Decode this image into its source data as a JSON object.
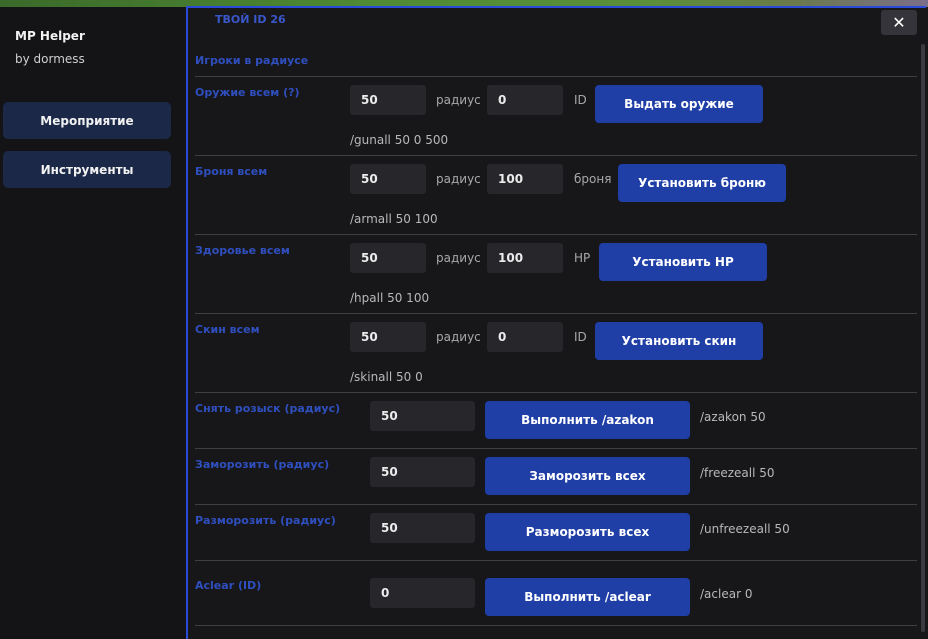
{
  "sidebar": {
    "title": "MP Helper",
    "subtitle": "by dormess",
    "nav": [
      "Мероприятие",
      "Инструменты"
    ]
  },
  "header": {
    "id_label": "ТВОЙ ID  26",
    "close_symbol": "✕"
  },
  "players_section": "Игроки в радиусе",
  "rows": [
    {
      "title": "Оружие всем (?)",
      "radius": "50",
      "radius_unit": "радиус",
      "value": "0",
      "value_unit": "ID",
      "button": "Выдать оружие",
      "command": "/gunall 50 0 500"
    },
    {
      "title": "Броня всем",
      "radius": "50",
      "radius_unit": "радиус",
      "value": "100",
      "value_unit": "броня",
      "button": "Установить броню",
      "command": "/armall 50 100"
    },
    {
      "title": "Здоровье всем",
      "radius": "50",
      "radius_unit": "радиус",
      "value": "100",
      "value_unit": "HP",
      "button": "Установить HP",
      "command": "/hpall 50 100"
    },
    {
      "title": "Скин всем",
      "radius": "50",
      "radius_unit": "радиус",
      "value": "0",
      "value_unit": "ID",
      "button": "Установить скин",
      "command": "/skinall 50 0"
    }
  ],
  "simple_rows": [
    {
      "title": "Снять розыск (радиус)",
      "value": "50",
      "button": "Выполнить /azakon",
      "command": "/azakon 50"
    },
    {
      "title": "Заморозить (радиус)",
      "value": "50",
      "button": "Заморозить всех",
      "command": "/freezeall 50"
    },
    {
      "title": "Разморозить (радиус)",
      "value": "50",
      "button": "Разморозить всех",
      "command": "/unfreezeall 50"
    },
    {
      "title": "Aclear (ID)",
      "value": "0",
      "button": "Выполнить /aclear",
      "command": "/aclear 0"
    }
  ]
}
